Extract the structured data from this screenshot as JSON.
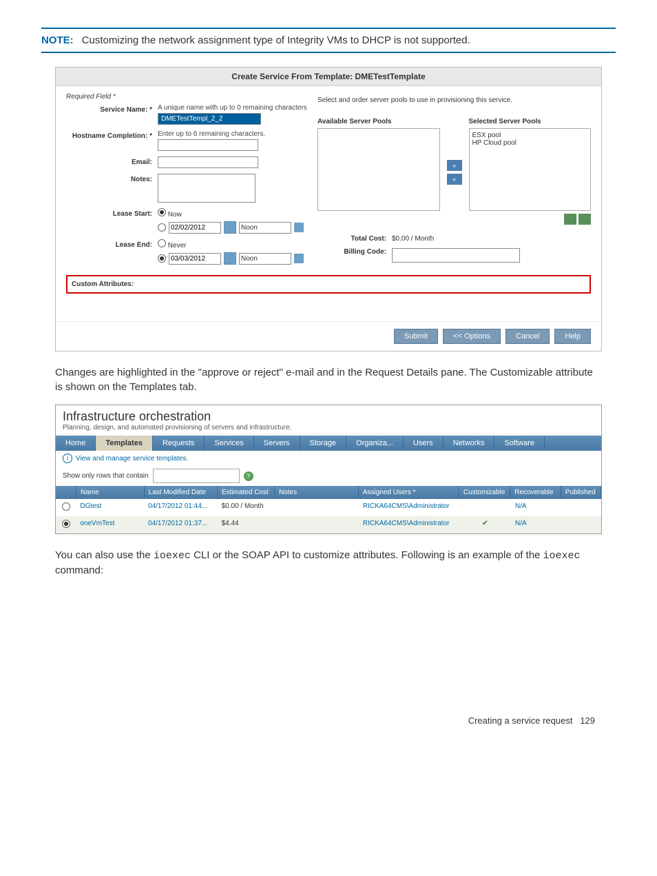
{
  "note": {
    "label": "NOTE:",
    "text": "Customizing the network assignment type of Integrity VMs to DHCP is not supported."
  },
  "dialog": {
    "title": "Create Service From Template: DMETestTemplate",
    "required": "Required Field *",
    "serviceName": {
      "label": "Service Name: *",
      "hint": "A unique name with up to 0 remaining characters",
      "value": "DMETestTempl_2_2"
    },
    "hostname": {
      "label": "Hostname Completion: *",
      "hint": "Enter up to 6 remaining characters."
    },
    "email": {
      "label": "Email:"
    },
    "notes": {
      "label": "Notes:"
    },
    "leaseStart": {
      "label": "Lease Start:",
      "now": "Now",
      "date": "02/02/2012",
      "time": "Noon"
    },
    "leaseEnd": {
      "label": "Lease End:",
      "never": "Never",
      "date": "03/03/2012",
      "time": "Noon"
    },
    "customAttr": "Custom Attributes:",
    "rightHint": "Select and order server pools to use in provisioning this service.",
    "available": {
      "header": "Available Server Pools"
    },
    "selected": {
      "header": "Selected Server Pools",
      "items": [
        "ESX pool",
        "HP Cloud pool"
      ]
    },
    "moveRight": "»",
    "moveLeft": "«",
    "totalCost": {
      "label": "Total Cost:",
      "value": "$0.00 / Month"
    },
    "billing": {
      "label": "Billing Code:"
    },
    "buttons": {
      "submit": "Submit",
      "options": "<< Options",
      "cancel": "Cancel",
      "help": "Help"
    }
  },
  "para1": "Changes are highlighted in the \"approve or reject\" e-mail and in the Request Details pane. The Customizable attribute is shown on the Templates tab.",
  "io": {
    "title": "Infrastructure orchestration",
    "subtitle": "Planning, design, and automated provisioning of servers and infrastructure.",
    "tabs": [
      "Home",
      "Templates",
      "Requests",
      "Services",
      "Servers",
      "Storage",
      "Organiza...",
      "Users",
      "Networks",
      "Software"
    ],
    "activeTab": 1,
    "info": "View and manage service templates.",
    "filterLabel": "Show only rows that contain",
    "columns": [
      "",
      "Name",
      "Last Modified Date",
      "Estimated Cost",
      "Notes",
      "Assigned Users *",
      "Customizable",
      "Recoverable",
      "Published"
    ],
    "rows": [
      {
        "sel": false,
        "name": "DGtest",
        "modified": "04/17/2012 01:44...",
        "cost": "$0.00 / Month",
        "notes": "",
        "users": "RICKA64CMS\\Administrator",
        "custom": "",
        "recover": "N/A",
        "publ": ""
      },
      {
        "sel": true,
        "name": "oneVmTest",
        "modified": "04/17/2012 01:37...",
        "cost": "$4.44",
        "notes": "",
        "users": "RICKA64CMS\\Administrator",
        "custom": "check",
        "recover": "N/A",
        "publ": ""
      }
    ]
  },
  "para2a": "You can also use the ",
  "para2b": "ioexec",
  "para2c": " CLI or the SOAP API to customize attributes. Following is an example of the ",
  "para2d": "ioexec",
  "para2e": " command:",
  "footer": {
    "text": "Creating a service request",
    "page": "129"
  }
}
